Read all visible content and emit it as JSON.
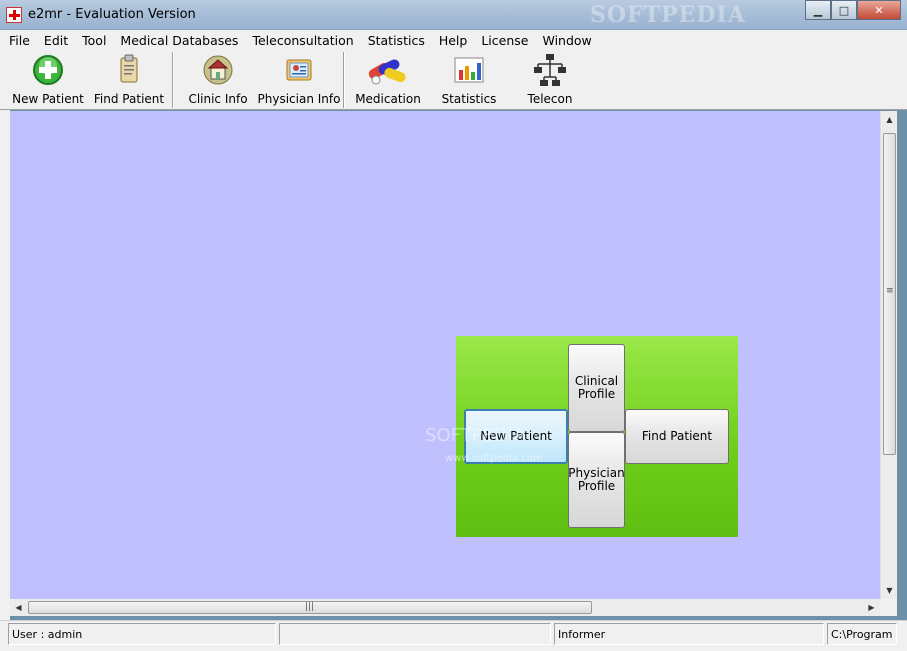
{
  "window": {
    "title": "e2mr - Evaluation Version",
    "watermark": "SOFTPEDIA",
    "buttons": {
      "minimize": "▁",
      "maximize": "□",
      "close": "✕"
    }
  },
  "menu": [
    "File",
    "Edit",
    "Tool",
    "Medical Databases",
    "Teleconsultation",
    "Statistics",
    "Help",
    "License",
    "Window"
  ],
  "toolbar": {
    "new_patient": "New Patient",
    "find_patient": "Find Patient",
    "clinic_info": "Clinic Info",
    "physician_info": "Physician Info",
    "medication": "Medication",
    "statistics": "Statistics",
    "telecon": "Telecon"
  },
  "launcher": {
    "clinical_profile": "Clinical\nProfile",
    "new_patient": "New Patient",
    "find_patient": "Find Patient",
    "physician_profile": "Physician\nProfile"
  },
  "overlay_watermark": {
    "main": "SOFTPEDIA",
    "url": "www.softpedia.com"
  },
  "statusbar": {
    "user": "User : admin",
    "middle": "",
    "informer": "Informer",
    "path": "C:\\Program"
  },
  "colors": {
    "client_bg": "#c0c0ff",
    "launcher_green": "#6fcf1a"
  }
}
